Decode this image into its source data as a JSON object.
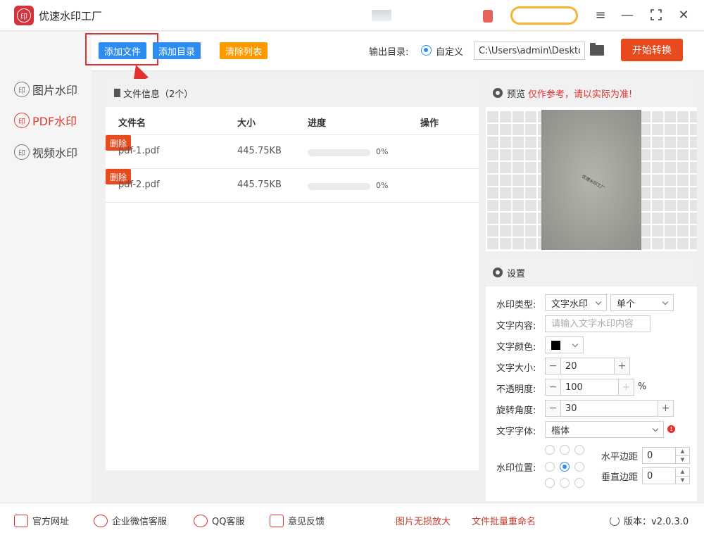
{
  "app": {
    "title": "优速水印工厂",
    "logo_text": "印"
  },
  "sidebar": {
    "items": [
      {
        "label": "图片水印",
        "icon": "印"
      },
      {
        "label": "PDF水印",
        "icon": "印",
        "active": true
      },
      {
        "label": "视频水印",
        "icon": "印"
      }
    ]
  },
  "toolbar": {
    "add_file": "添加文件",
    "add_dir": "添加目录",
    "clear_list": "清除列表",
    "output_label": "输出目录:",
    "custom_label": "自定义",
    "output_path": "C:\\Users\\admin\\Deskto",
    "start": "开始转换"
  },
  "files": {
    "header": "文件信息（2个）",
    "columns": {
      "name": "文件名",
      "size": "大小",
      "progress": "进度",
      "action": "操作"
    },
    "rows": [
      {
        "name": "pdf-1.pdf",
        "size": "445.75KB",
        "progress": 0,
        "progress_text": "0%",
        "action": "删除"
      },
      {
        "name": "pdf-2.pdf",
        "size": "445.75KB",
        "progress": 0,
        "progress_text": "0%",
        "action": "删除"
      }
    ]
  },
  "preview": {
    "title": "预览",
    "note": "仅作参考，请以实际为准!",
    "watermark_text": "优速水印工厂"
  },
  "settings": {
    "title": "设置",
    "type_label": "水印类型:",
    "type_value": "文字水印",
    "mode_value": "单个",
    "content_label": "文字内容:",
    "content_placeholder": "请输入文字水印内容",
    "color_label": "文字颜色:",
    "color_value": "#000000",
    "size_label": "文字大小:",
    "size_value": "20",
    "opacity_label": "不透明度:",
    "opacity_value": "100",
    "opacity_unit": "%",
    "rotation_label": "旋转角度:",
    "rotation_value": "30",
    "font_label": "文字字体:",
    "font_value": "楷体",
    "position_label": "水印位置:",
    "position_selected": "middle-center",
    "h_margin_label": "水平边距",
    "h_margin_value": "0",
    "v_margin_label": "垂直边距",
    "v_margin_value": "0"
  },
  "footer": {
    "website": "官方网址",
    "wechat": "企业微信客服",
    "qq": "QQ客服",
    "feedback": "意见反馈",
    "link1": "图片无损放大",
    "link2": "文件批量重命名",
    "version_label": "版本：v2.0.3.0"
  },
  "colors": {
    "accent_blue": "#2d8cf0",
    "accent_red": "#e8491d",
    "accent_orange": "#ff9900"
  }
}
